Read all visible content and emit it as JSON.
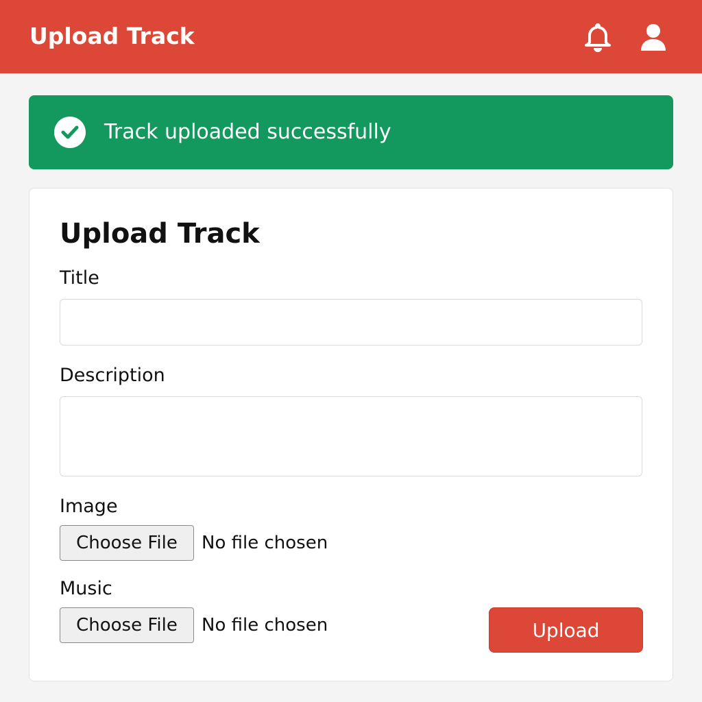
{
  "header": {
    "title": "Upload Track",
    "icons": [
      "bell-icon",
      "user-icon"
    ]
  },
  "alert": {
    "message": "Track uploaded successfully",
    "icon": "check-circle-icon",
    "color": "#13995e"
  },
  "form": {
    "heading": "Upload Track",
    "title_label": "Title",
    "title_value": "",
    "description_label": "Description",
    "description_value": "",
    "image_label": "Image",
    "image_button": "Choose File",
    "image_status": "No file chosen",
    "music_label": "Music",
    "music_button": "Choose File",
    "music_status": "No file chosen",
    "submit_label": "Upload"
  },
  "colors": {
    "brand": "#dc4737",
    "success": "#13995e",
    "background": "#f4f4f4"
  }
}
